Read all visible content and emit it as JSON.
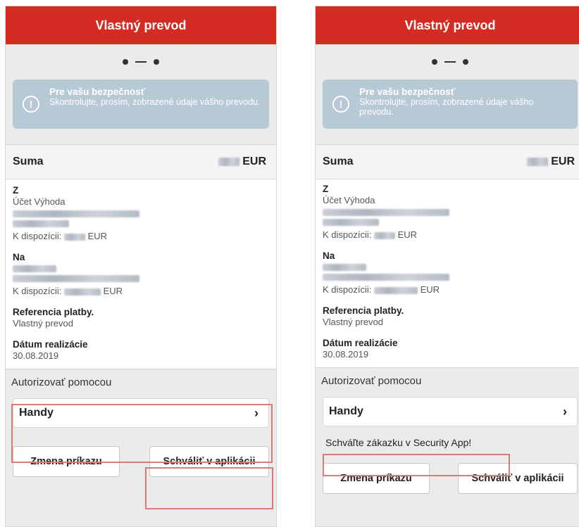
{
  "screens": [
    {
      "title": "Vlastný prevod",
      "notice": {
        "title": "Pre vašu bezpečnosť",
        "text": "Skontrolujte, prosím, zobrazené údaje vášho prevodu."
      },
      "sum": {
        "label": "Suma",
        "currency": "EUR"
      },
      "from": {
        "label": "Z",
        "account_name": "Účet Výhoda",
        "available_prefix": "K dispozícii:",
        "available_currency": "EUR"
      },
      "to": {
        "label": "Na",
        "available_prefix": "K dispozícii:",
        "available_currency": "EUR"
      },
      "reference": {
        "label": "Referencia platby.",
        "value": "Vlastný prevod"
      },
      "date": {
        "label": "Dátum realizácie",
        "value": "30.08.2019"
      },
      "authorize_label": "Autorizovať pomocou",
      "method": "Handy",
      "buttons": {
        "change": "Zmena príkazu",
        "approve": "Schváliť v aplikácii"
      }
    },
    {
      "title": "Vlastný prevod",
      "notice": {
        "title": "Pre vašu bezpečnosť",
        "text": "Skontrolujte, prosím, zobrazené údaje vášho prevodu."
      },
      "sum": {
        "label": "Suma",
        "currency": "EUR"
      },
      "from": {
        "label": "Z",
        "account_name": "Účet Výhoda",
        "available_prefix": "K dispozícii:",
        "available_currency": "EUR"
      },
      "to": {
        "label": "Na",
        "available_prefix": "K dispozícii:",
        "available_currency": "EUR"
      },
      "reference": {
        "label": "Referencia platby.",
        "value": "Vlastný prevod"
      },
      "date": {
        "label": "Dátum realizácie",
        "value": "30.08.2019"
      },
      "authorize_label": "Autorizovať pomocou",
      "method": "Handy",
      "security_message": "Schváľte zákazku v Security App!",
      "buttons": {
        "change": "Zmena príkazu",
        "approve": "Schváliť v aplikácii"
      }
    }
  ],
  "colors": {
    "brand_red": "#d52b22",
    "notice_bg": "#b8c9d6",
    "highlight": "#d97b7b"
  }
}
